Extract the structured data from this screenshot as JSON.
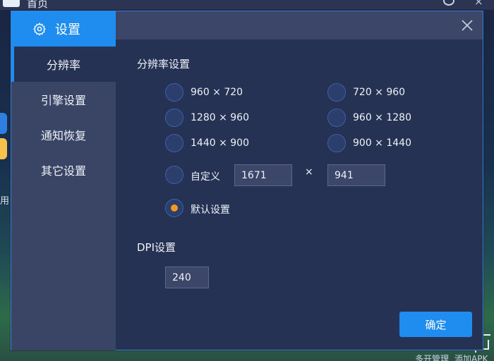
{
  "background": {
    "home_title": "首页",
    "side_label": "用",
    "bottom_left_text": "多开管理",
    "bottom_right_text": "添加APK"
  },
  "dialog": {
    "title": "设置",
    "title_icon": "gear-icon",
    "close_icon": "close-icon",
    "accent_color": "#1f8df0",
    "selected_color": "#f39a1e"
  },
  "sidebar": {
    "items": [
      {
        "label": "分辨率",
        "active": true
      },
      {
        "label": "引擎设置",
        "active": false
      },
      {
        "label": "通知恢复",
        "active": false
      },
      {
        "label": "其它设置",
        "active": false
      }
    ]
  },
  "resolution": {
    "section_title": "分辨率设置",
    "options": [
      {
        "label": "960 × 720",
        "checked": false
      },
      {
        "label": "720 × 960",
        "checked": false
      },
      {
        "label": "1280 × 960",
        "checked": false
      },
      {
        "label": "960 × 1280",
        "checked": false
      },
      {
        "label": "1440 × 900",
        "checked": false
      },
      {
        "label": "900 × 1440",
        "checked": false
      }
    ],
    "custom": {
      "label": "自定义",
      "width": "1671",
      "height": "941",
      "separator": "×",
      "checked": false
    },
    "default": {
      "label": "默认设置",
      "checked": true
    }
  },
  "dpi": {
    "section_title": "DPI设置",
    "value": "240"
  },
  "footer": {
    "confirm_label": "确定"
  }
}
